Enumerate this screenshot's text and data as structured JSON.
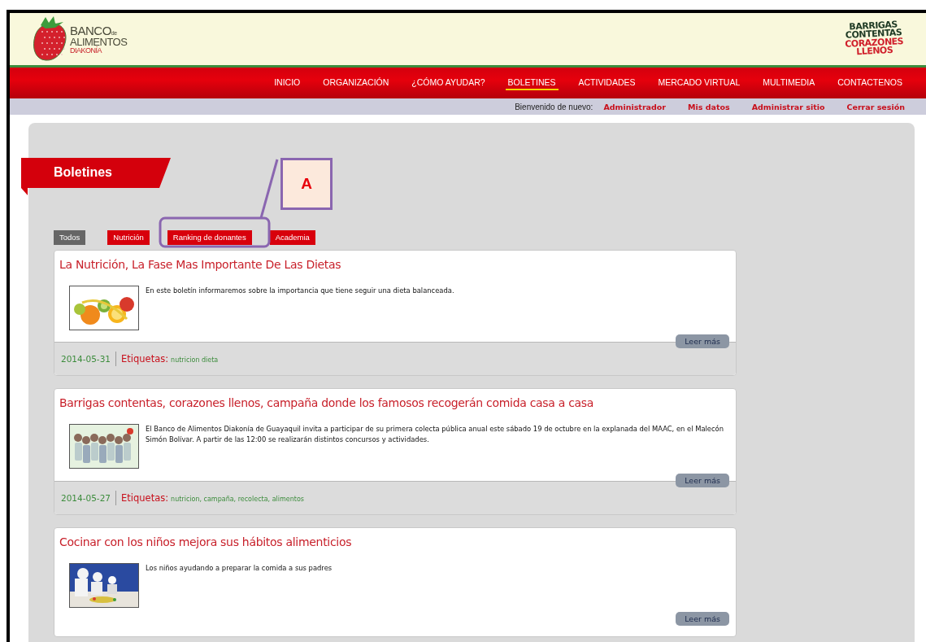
{
  "header": {
    "logo": {
      "line_1": "BANCO",
      "line_1_small": "de",
      "line_2": "ALIMENTOS",
      "line_3": "DIAKONÍA"
    },
    "campaign_logo": [
      {
        "text": "BARRIGAS",
        "color": "#1f3a24"
      },
      {
        "text": "CONTENTAS",
        "color": "#1f3a24"
      },
      {
        "text": "CORAZONES",
        "color": "#d0202c"
      },
      {
        "text": "LLENOS",
        "color": "#d0202c"
      }
    ]
  },
  "nav": [
    {
      "label": "INICIO",
      "selected": false
    },
    {
      "label": "ORGANIZACIÓN",
      "selected": false
    },
    {
      "label": "¿CÓMO AYUDAR?",
      "selected": false
    },
    {
      "label": "BOLETINES",
      "selected": true
    },
    {
      "label": "ACTIVIDADES",
      "selected": false
    },
    {
      "label": "MERCADO VIRTUAL",
      "selected": false
    },
    {
      "label": "MULTIMEDIA",
      "selected": false
    },
    {
      "label": "CONTACTENOS",
      "selected": false
    }
  ],
  "user_bar": {
    "greeting": "Bienvenido de nuevo:",
    "links": [
      "Administrador",
      "Mis datos",
      "Administrar sitio",
      "Cerrar sesión"
    ]
  },
  "section_title": "Boletines",
  "filters": [
    {
      "label": "Todos",
      "selected": true
    },
    {
      "label": "Nutrición",
      "selected": false
    },
    {
      "label": "Ranking de donantes",
      "selected": false
    },
    {
      "label": "Academia",
      "selected": false
    }
  ],
  "annotation": {
    "label": "A"
  },
  "posts": [
    {
      "title": "La Nutrición, La Fase Mas Importante De Las Dietas",
      "summary": "En este boletín informaremos sobre la importancia que tiene seguir una dieta balanceada.",
      "read_more": "Leer más",
      "date": "2014-05-31",
      "tags_label": "Etiquetas:",
      "tags": "nutricion dieta"
    },
    {
      "title": "Barrigas contentas, corazones llenos, campaña donde los famosos recogerán comida casa a casa",
      "summary": "El Banco de Alimentos Diakonía de Guayaquil invita a participar de su primera colecta pública anual este sábado 19 de octubre en la explanada del MAAC, en el Malecón Simón Bolívar. A partir de las 12:00 se realizarán distintos concursos y actividades.",
      "read_more": "Leer más",
      "date": "2014-05-27",
      "tags_label": "Etiquetas:",
      "tags": "nutricion, campaña, recolecta, alimentos"
    },
    {
      "title": "Cocinar con los niños mejora sus hábitos alimenticios",
      "summary": "Los niños ayudando a preparar la comida a sus padres",
      "read_more": "Leer más"
    }
  ]
}
